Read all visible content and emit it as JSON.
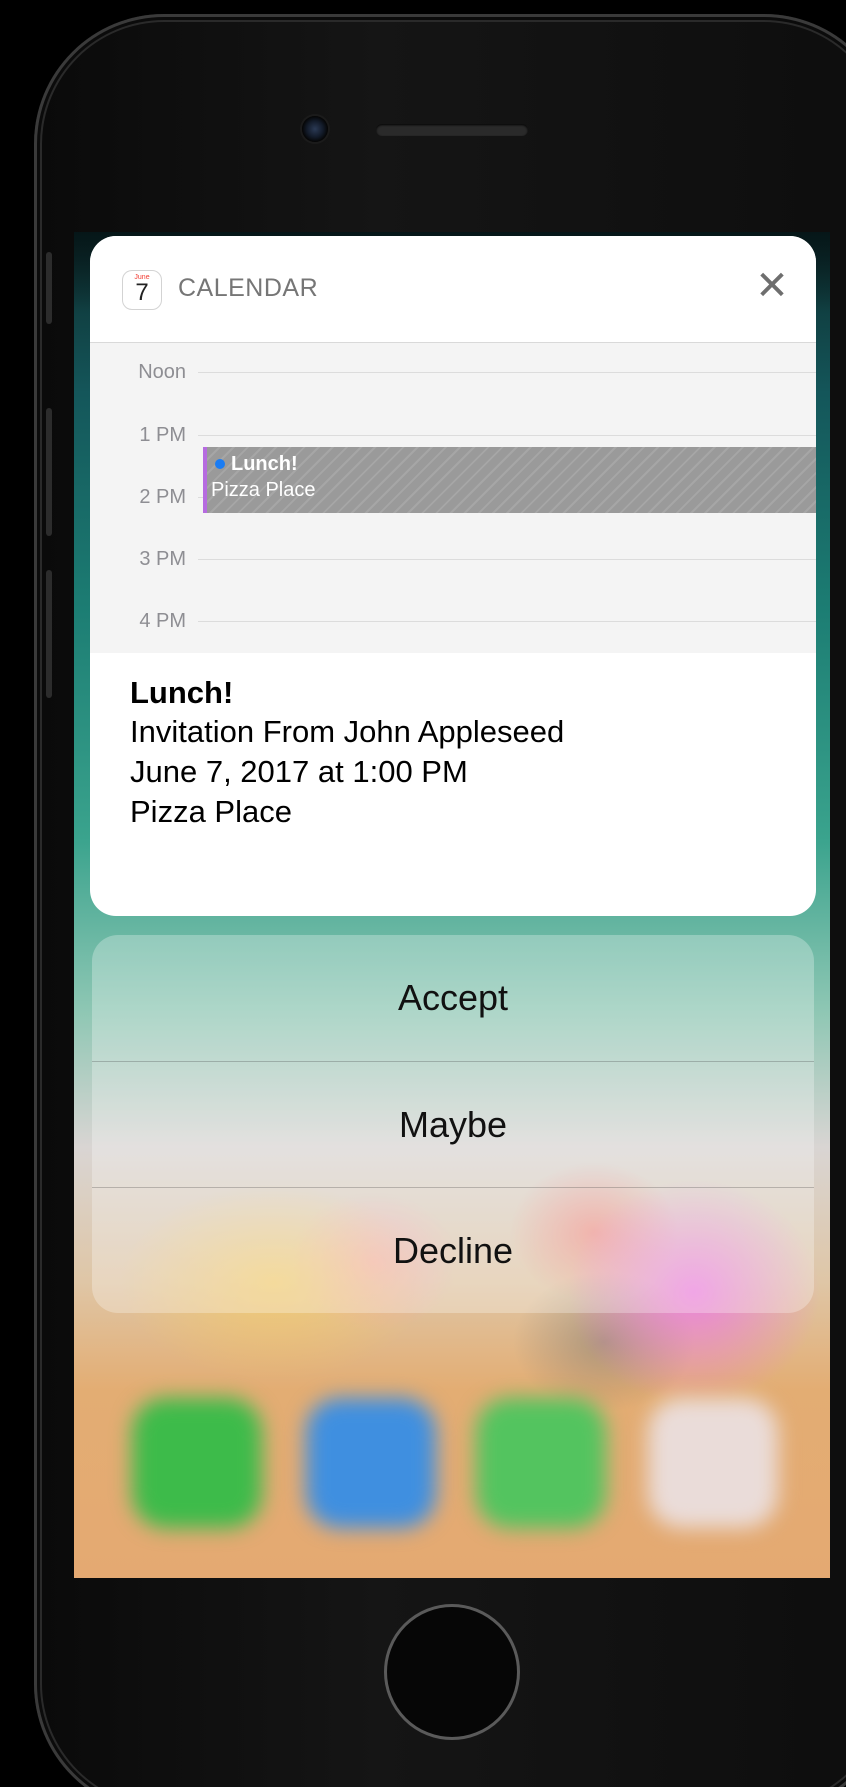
{
  "notification": {
    "app_name": "CALENDAR",
    "app_icon": {
      "month": "June",
      "day": "7",
      "name": "calendar-icon"
    },
    "close_label": "✕"
  },
  "day_view": {
    "hours": [
      "Noon",
      "1 PM",
      "2 PM",
      "3 PM",
      "4 PM"
    ],
    "event": {
      "title": "Lunch!",
      "location": "Pizza Place",
      "calendar_color": "#b66be0",
      "dot_color": "#1a7cf3"
    }
  },
  "details": {
    "title": "Lunch!",
    "invitation": "Invitation From John Appleseed",
    "datetime": "June 7, 2017 at 1:00 PM",
    "location": "Pizza Place"
  },
  "actions": [
    {
      "label": "Accept"
    },
    {
      "label": "Maybe"
    },
    {
      "label": "Decline"
    }
  ],
  "dock_icons": [
    "phone-app-icon",
    "safari-app-icon",
    "messages-app-icon",
    "music-app-icon"
  ]
}
